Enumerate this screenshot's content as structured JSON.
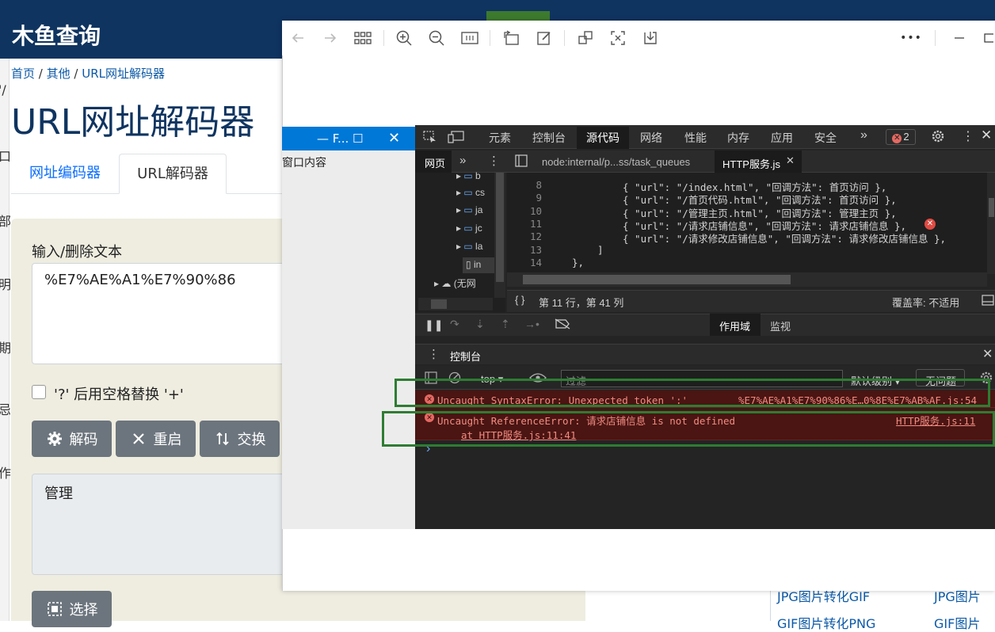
{
  "site": {
    "logo": "木鱼查询",
    "breadcrumb": {
      "home": "首页",
      "sep": " / ",
      "other": "其他",
      "current": "URL网址解码器"
    },
    "title": "URL网址解码器",
    "tabs": [
      "网址编码器",
      "URL解码器"
    ],
    "input_label": "输入/删除文本",
    "input_value": "%E7%AE%A1%E7%90%86",
    "checkbox_label": "'?' 后用空格替换 '+'",
    "buttons": {
      "decode": "解码",
      "reset": "重启",
      "swap": "交换",
      "select": "选择"
    },
    "output_value": "管理",
    "bottom_links": [
      "JPG图片转化GIF",
      "JPG图片",
      "GIF图片转化PNG",
      "GIF图片"
    ]
  },
  "viewer": {
    "toolbar_icons": [
      "back-icon",
      "forward-icon",
      "grid-icon",
      "zoom-in-icon",
      "zoom-out-icon",
      "fit-icon",
      "rotate-icon",
      "edit-icon",
      "crop-icon",
      "scan-icon",
      "save-icon",
      "more-icon",
      "minimize-icon",
      "maximize-icon"
    ],
    "more_label": "•••"
  },
  "inner_window": {
    "title": "— F... ☐",
    "close": "✕",
    "content": "窗口内容"
  },
  "devtools": {
    "top_tabs": [
      "元素",
      "控制台",
      "源代码",
      "网络",
      "性能",
      "内存",
      "应用",
      "安全"
    ],
    "active_top_tab": "源代码",
    "more_tabs": "»",
    "error_count": "2",
    "nav_tab": "网页",
    "file_tabs": [
      "node:internal/p...ss/task_queues",
      "HTTP服务.js"
    ],
    "tree_items": [
      "b",
      "cs",
      "ja",
      "jc",
      "la",
      "in"
    ],
    "tree_cloud": "(无网",
    "code_lines": [
      {
        "n": "8",
        "t": "{ \"url\": \"/index.html\", \"回调方法\": 首页访问 },"
      },
      {
        "n": "9",
        "t": "{ \"url\": \"/首页代码.html\", \"回调方法\": 首页访问 },"
      },
      {
        "n": "10",
        "t": "{ \"url\": \"/管理主页.html\", \"回调方法\": 管理主页 },"
      },
      {
        "n": "11",
        "t": "{ \"url\": \"/请求店铺信息\", \"回调方法\": 请求店铺信息 },"
      },
      {
        "n": "12",
        "t": "{ \"url\": \"/请求修改店铺信息\", \"回调方法\": 请求修改店铺信息 },"
      },
      {
        "n": "13",
        "t": "]"
      },
      {
        "n": "14",
        "t": "},"
      }
    ],
    "status_position": "第 11 行，第 41 列",
    "coverage": "覆盖率: 不适用",
    "scope_tab": "作用域",
    "watch_tab": "监视",
    "console_title": "控制台",
    "context": "top",
    "filter_placeholder": "过滤",
    "level": "默认级别",
    "no_issues": "无问题",
    "errors": [
      {
        "message": "Uncaught SyntaxError: Unexpected token ':'",
        "source": "%E7%AE%A1%E7%90%86%E…0%8E%E7%AB%AF.js:54"
      },
      {
        "message": "Uncaught ReferenceError: 请求店铺信息 is not defined",
        "source": "HTTP服务.js:11",
        "stack": "at HTTP服务.js:11:41"
      }
    ],
    "prompt": "›"
  }
}
